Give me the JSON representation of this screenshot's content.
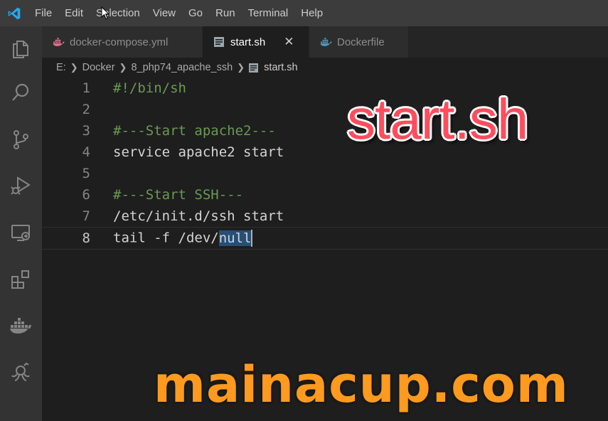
{
  "menu": [
    "File",
    "Edit",
    "Selection",
    "View",
    "Go",
    "Run",
    "Terminal",
    "Help"
  ],
  "tabs": [
    {
      "label": "docker-compose.yml",
      "icon": "docker-icon",
      "active": false
    },
    {
      "label": "start.sh",
      "icon": "file-icon",
      "active": true
    },
    {
      "label": "Dockerfile",
      "icon": "docker-icon",
      "active": false
    }
  ],
  "breadcrumb": [
    "E:",
    "Docker",
    "8_php74_apache_ssh",
    "start.sh"
  ],
  "editor": {
    "lines": [
      {
        "n": "1",
        "text": "#!/bin/sh",
        "type": "comment"
      },
      {
        "n": "2",
        "text": "",
        "type": "plain"
      },
      {
        "n": "3",
        "text": "#---Start apache2---",
        "type": "comment"
      },
      {
        "n": "4",
        "text": "service apache2 start",
        "type": "plain"
      },
      {
        "n": "5",
        "text": "",
        "type": "plain"
      },
      {
        "n": "6",
        "text": "#---Start SSH---",
        "type": "comment"
      },
      {
        "n": "7",
        "text": "/etc/init.d/ssh start",
        "type": "plain"
      },
      {
        "n": "8",
        "text_before": "tail -f /dev/",
        "text_selected": "null",
        "type": "plain"
      }
    ]
  },
  "overlay": {
    "title": "start.sh",
    "site": "mainacup.com"
  },
  "colors": {
    "accent_blue": "#007acc",
    "comment_green": "#6a9955",
    "docker_blue": "#519aba",
    "docker_pink": "#e37093",
    "overlay_red": "#ff4d5e",
    "overlay_orange": "#ff9a1f"
  }
}
